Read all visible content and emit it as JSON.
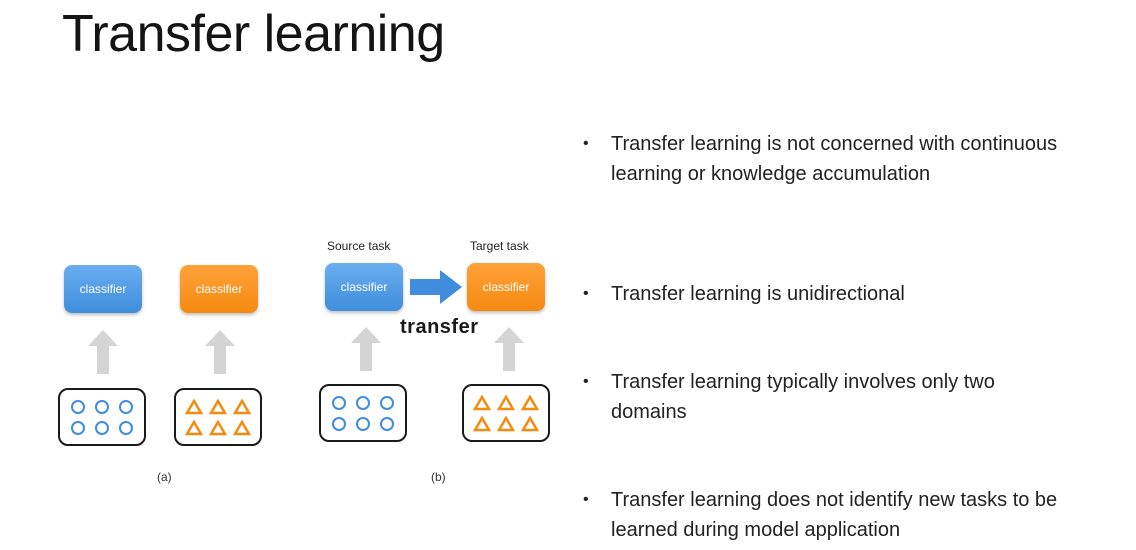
{
  "title": "Transfer learning",
  "diagram": {
    "classifier_label": "classifier",
    "source_task_label": "Source task",
    "target_task_label": "Target task",
    "transfer_label": "transfer",
    "caption_a": "(a)",
    "caption_b": "(b)",
    "colors": {
      "blue": "#3f8ddc",
      "orange": "#f58a10",
      "arrow_gray": "#d4d4d4"
    }
  },
  "bullets": [
    "Transfer learning is not concerned with continuous learning or knowledge accumulation",
    "Transfer learning is unidirectional",
    "Transfer learning typically involves only two domains",
    "Transfer learning does not identify new tasks to be learned during model application"
  ]
}
